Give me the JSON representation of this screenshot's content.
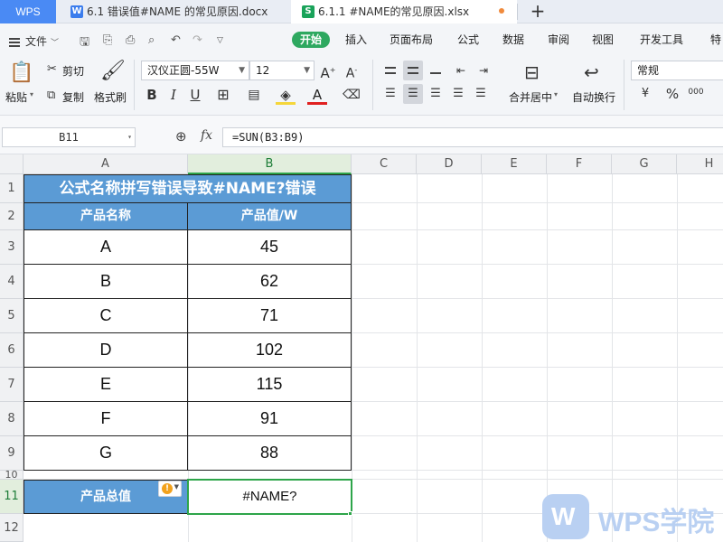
{
  "tabs": {
    "app": "WPS",
    "doc1": "6.1 错误值#NAME 的常见原因.docx",
    "doc2": "6.1.1 #NAME的常见原因.xlsx",
    "new_tab": "+"
  },
  "menu": {
    "file": "文件",
    "tabs": [
      "开始",
      "插入",
      "页面布局",
      "公式",
      "数据",
      "审阅",
      "视图",
      "开发工具",
      "特"
    ],
    "active_tab": "开始"
  },
  "ribbon": {
    "paste": "粘贴",
    "cut": "剪切",
    "copy": "复制",
    "format_painter": "格式刷",
    "font_name": "汉仪正圆-55W",
    "font_size": "12",
    "merge_center": "合并居中",
    "wrap_text": "自动换行",
    "number_format": "常规",
    "percent": "%",
    "thousands": "000"
  },
  "formula_bar": {
    "name_box": "B11",
    "fx": "fx",
    "formula": "=SUN(B3:B9)"
  },
  "columns": [
    "A",
    "B",
    "C",
    "D",
    "E",
    "F",
    "G",
    "H"
  ],
  "selected_column": "B",
  "rows": [
    "1",
    "2",
    "3",
    "4",
    "5",
    "6",
    "7",
    "8",
    "9",
    "10",
    "11",
    "12"
  ],
  "selected_row": "11",
  "sheet": {
    "title": "公式名称拼写错误导致#NAME?错误",
    "headers": [
      "产品名称",
      "产品值/W"
    ],
    "data": [
      [
        "A",
        "45"
      ],
      [
        "B",
        "62"
      ],
      [
        "C",
        "71"
      ],
      [
        "D",
        "102"
      ],
      [
        "E",
        "115"
      ],
      [
        "F",
        "91"
      ],
      [
        "G",
        "88"
      ]
    ],
    "total_label": "产品总值",
    "total_value": "#NAME?",
    "error_indicator": "!"
  },
  "watermark": {
    "logo_letter": "W",
    "text": "WPS学院"
  },
  "colors": {
    "header_fill": "#5b9bd5",
    "selection_green": "#2ea54a",
    "active_tab_green": "#2ea860",
    "app_tab_blue": "#4a8af4"
  }
}
